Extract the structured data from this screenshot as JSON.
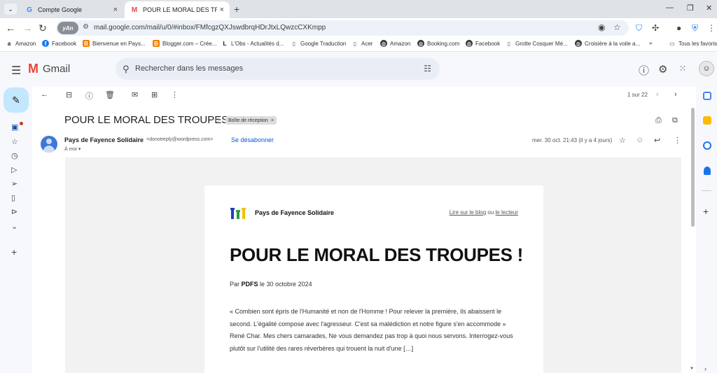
{
  "browser": {
    "tabs": [
      {
        "title": "Compte Google",
        "favicon": "G"
      },
      {
        "title": "POUR LE MORAL DES TROUPES",
        "favicon": "M"
      }
    ],
    "new_tab": "+",
    "url": "mail.google.com/mail/u/0/#inbox/FMfcgzQXJswdbrqHDrJtxLQwzcCXKmpp",
    "badge": "yAn",
    "bookmarks": [
      "Amazon",
      "Facebook",
      "Bienvenue en Pays...",
      "Blogger.com – Crée...",
      "L'Obs - Actualités d...",
      "Google Traduction",
      "Acer",
      "Amazon",
      "Booking.com",
      "Facebook",
      "Grotte Cosquer Mé...",
      "Croisière à la voile a..."
    ],
    "bookmarks_more": "»",
    "all_bookmarks": "Tous les favoris"
  },
  "gmail": {
    "logo_text": "Gmail",
    "search_placeholder": "Rechercher dans les messages",
    "pager": "1 sur 22",
    "subject": "POUR LE MORAL DES TROUPES !",
    "label": "Boîte de réception",
    "label_close": "×",
    "sender_name": "Pays de Fayence Solidaire",
    "sender_email": "<donotreply@wordpress.com>",
    "unsubscribe": "Se désabonner",
    "to": "À moi",
    "date": "mer. 30 oct. 21:43 (il y a 4 jours)"
  },
  "email": {
    "brand": "Pays de Fayence Solidaire",
    "link_blog": "Lire sur le blog",
    "link_or": " ou ",
    "link_reader": "le lecteur",
    "headline": "POUR LE MORAL DES TROUPES !",
    "by": "Par ",
    "author": "PDFS",
    "date_text": " le 30 octobre 2024",
    "excerpt": "« Combien sont épris de l'Humanité et non de l'Homme ! Pour relever la première, ils abaissent le second. L'égalité compose avec l'agresseur. C'est sa malédiction et notre figure s'en accommode » René Char. Mes chers camarades, Ne vous demandez pas trop à quoi nous servons. Interrogez-vous plutôt sur l'utilité des rares réverbères qui trouent la nuit d'une […]"
  },
  "colors": {
    "accent": "#0b57d0",
    "compose": "#c2e7ff",
    "gmail_red": "#ea4335",
    "unread_dot": "#d93025"
  }
}
